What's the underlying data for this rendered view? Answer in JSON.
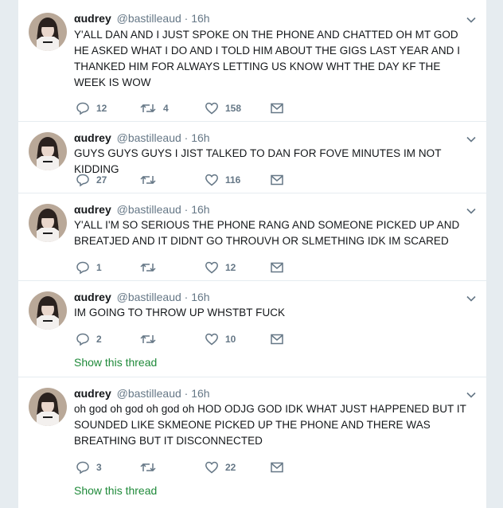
{
  "tweets": [
    {
      "name": "αudrey",
      "handle": "@bastilleaud",
      "dot": "·",
      "time": "16h",
      "text": "Y'ALL DAN AND I JUST SPOKE ON THE PHONE AND CHATTED OH MT GOD HE ASKED WHAT I DO AND I TOLD HIM ABOUT THE GIGS LAST YEAR AND I THANKED HIM FOR ALWAYS LETTING US KNOW WHT THE DAY KF THE WEEK IS WOW",
      "replies": "12",
      "retweets": "4",
      "likes": "158",
      "show_thread": ""
    },
    {
      "name": "αudrey",
      "handle": "@bastilleaud",
      "dot": "·",
      "time": "16h",
      "text": "GUYS GUYS GUYS I JIST TALKED TO DAN FOR FOVE MINUTES IM NOT KIDDING",
      "replies": "27",
      "retweets": "",
      "likes": "116",
      "show_thread": ""
    },
    {
      "name": "αudrey",
      "handle": "@bastilleaud",
      "dot": "·",
      "time": "16h",
      "text": "Y'ALL I'M SO SERIOUS THE PHONE RANG AND SOMEONE PICKED UP AND BREATJED AND IT DIDNT GO THROUVH OR SLMETHING IDK IM SCARED",
      "replies": "1",
      "retweets": "",
      "likes": "12",
      "show_thread": ""
    },
    {
      "name": "αudrey",
      "handle": "@bastilleaud",
      "dot": "·",
      "time": "16h",
      "text": "IM GOING TO THROW UP WHSTBT FUCK",
      "replies": "2",
      "retweets": "",
      "likes": "10",
      "show_thread": "Show this thread"
    },
    {
      "name": "αudrey",
      "handle": "@bastilleaud",
      "dot": "·",
      "time": "16h",
      "text": "oh god oh god oh god oh HOD ODJG GOD IDK WHAT JUST HAPPENED BUT IT SOUNDED LIKE SKMEONE PICKED UP THE PHONE AND THERE WAS BREATHING BUT IT DISCONNECTED",
      "replies": "3",
      "retweets": "",
      "likes": "22",
      "show_thread": "Show this thread"
    }
  ],
  "icons": {
    "reply": "reply-icon",
    "retweet": "retweet-icon",
    "like": "heart-icon",
    "dm": "envelope-icon",
    "caret": "chevron-down-icon"
  },
  "colors": {
    "action_gray": "#657786",
    "link_green": "#1f8a3a",
    "border": "#e6ecf0"
  }
}
